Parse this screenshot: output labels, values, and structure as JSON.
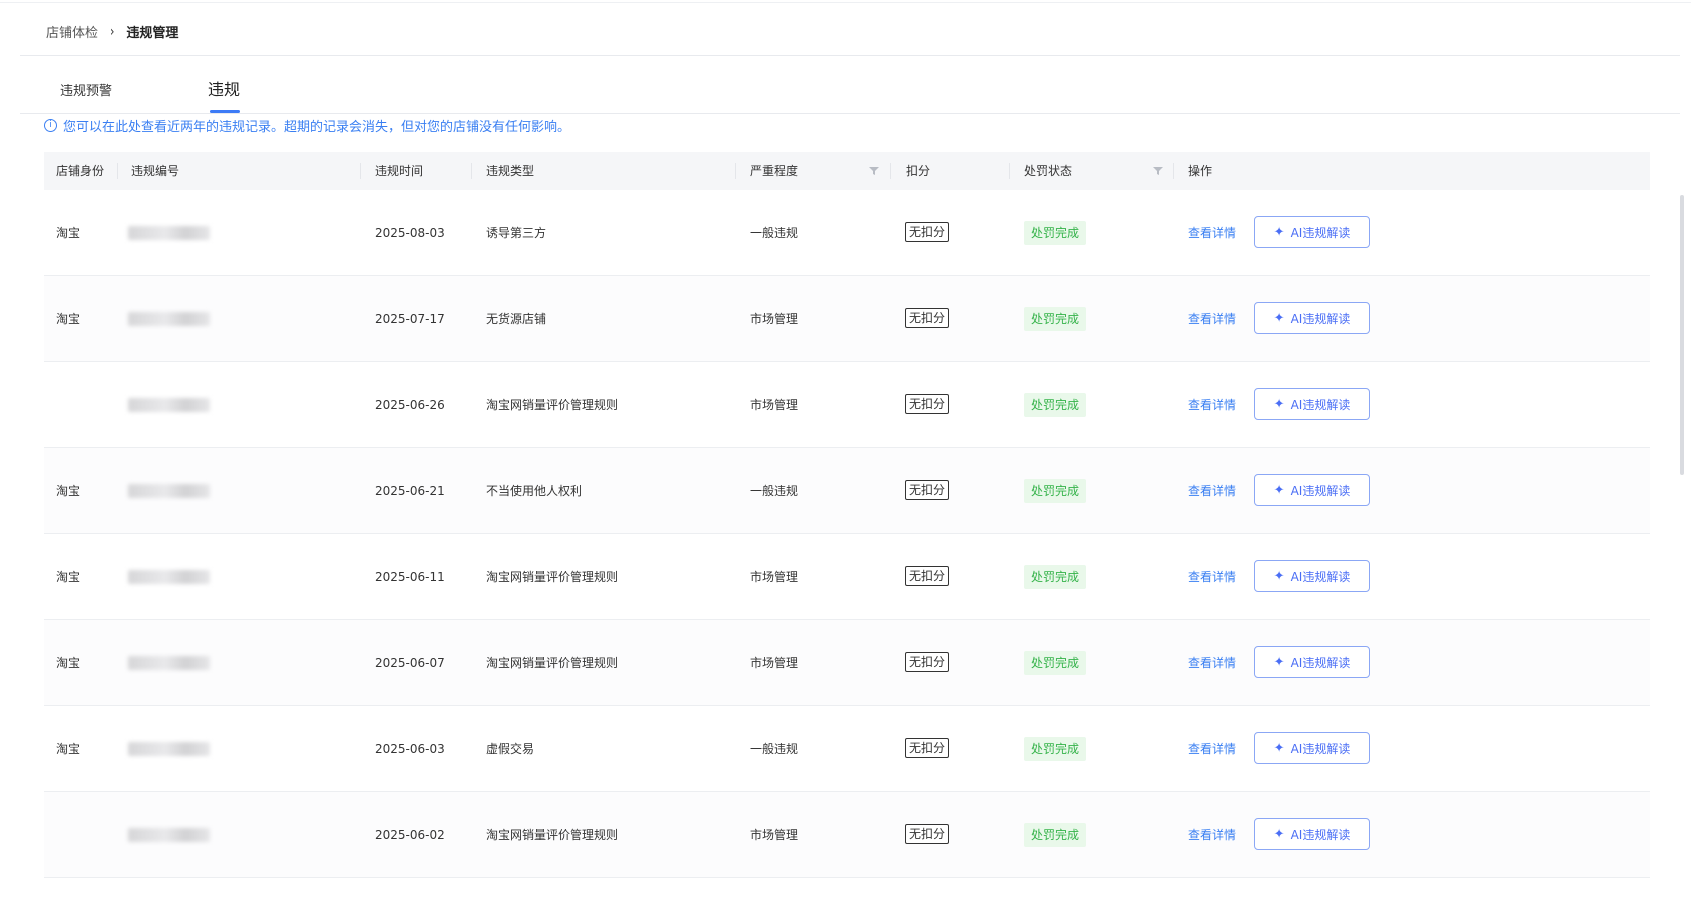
{
  "breadcrumb": {
    "parent": "店铺体检",
    "separator": "›",
    "current": "违规管理"
  },
  "tabs": [
    {
      "label": "违规预警",
      "active": false
    },
    {
      "label": "违规",
      "active": true
    }
  ],
  "notice": {
    "icon": "info-icon",
    "text": "您可以在此处查看近两年的违规记录。超期的记录会消失，但对您的店铺没有任何影响。"
  },
  "table": {
    "columns": [
      "店铺身份",
      "违规编号",
      "违规时间",
      "违规类型",
      "严重程度",
      "扣分",
      "处罚状态",
      "操作"
    ],
    "rows": [
      {
        "shop": "淘宝",
        "date": "2025-08-03",
        "type": "诱导第三方",
        "severity": "一般违规",
        "deduct": "无扣分",
        "status": "处罚完成",
        "action": "查看详情",
        "ai": "AI违规解读"
      },
      {
        "shop": "淘宝",
        "date": "2025-07-17",
        "type": "无货源店铺",
        "severity": "市场管理",
        "deduct": "无扣分",
        "status": "处罚完成",
        "action": "查看详情",
        "ai": "AI违规解读"
      },
      {
        "shop": "",
        "date": "2025-06-26",
        "type": "淘宝网销量评价管理规则",
        "severity": "市场管理",
        "deduct": "无扣分",
        "status": "处罚完成",
        "action": "查看详情",
        "ai": "AI违规解读"
      },
      {
        "shop": "淘宝",
        "date": "2025-06-21",
        "type": "不当使用他人权利",
        "severity": "一般违规",
        "deduct": "无扣分",
        "status": "处罚完成",
        "action": "查看详情",
        "ai": "AI违规解读"
      },
      {
        "shop": "淘宝",
        "date": "2025-06-11",
        "type": "淘宝网销量评价管理规则",
        "severity": "市场管理",
        "deduct": "无扣分",
        "status": "处罚完成",
        "action": "查看详情",
        "ai": "AI违规解读"
      },
      {
        "shop": "淘宝",
        "date": "2025-06-07",
        "type": "淘宝网销量评价管理规则",
        "severity": "市场管理",
        "deduct": "无扣分",
        "status": "处罚完成",
        "action": "查看详情",
        "ai": "AI违规解读"
      },
      {
        "shop": "淘宝",
        "date": "2025-06-03",
        "type": "虚假交易",
        "severity": "一般违规",
        "deduct": "无扣分",
        "status": "处罚完成",
        "action": "查看详情",
        "ai": "AI违规解读"
      },
      {
        "shop": "",
        "date": "2025-06-02",
        "type": "淘宝网销量评价管理规则",
        "severity": "市场管理",
        "deduct": "无扣分",
        "status": "处罚完成",
        "action": "查看详情",
        "ai": "AI违规解读"
      }
    ]
  },
  "colors": {
    "accent": "#3a7ff2",
    "status_bg": "#e9f8ea",
    "status_text": "#35b34a",
    "ai_border": "#8ba7f5"
  }
}
